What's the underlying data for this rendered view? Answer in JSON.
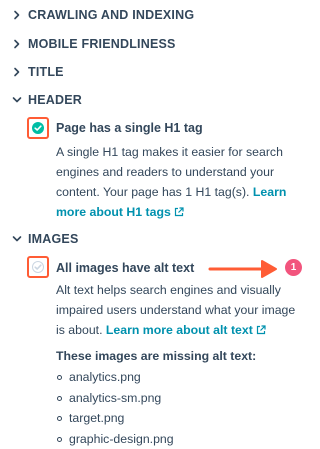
{
  "sections": [
    {
      "label": "CRAWLING AND INDEXING",
      "expanded": false
    },
    {
      "label": "MOBILE FRIENDLINESS",
      "expanded": false
    },
    {
      "label": "TITLE",
      "expanded": false
    },
    {
      "label": "HEADER",
      "expanded": true
    },
    {
      "label": "IMAGES",
      "expanded": true
    }
  ],
  "header": {
    "check_title": "Page has a single H1 tag",
    "status": "pass",
    "description": "A single H1 tag makes it easier for search engines and readers to understand your content. Your page has 1 H1 tag(s). ",
    "link": "Learn more about H1 tags"
  },
  "images": {
    "check_title": "All images have alt text",
    "status": "fail",
    "description": "Alt text helps search engines and visually impaired users understand what your image is about. ",
    "link": "Learn more about alt text",
    "missing_title": "These images are missing alt text:",
    "missing_list": [
      "analytics.png",
      "analytics-sm.png",
      "target.png",
      "graphic-design.png"
    ],
    "badge_count": "1"
  },
  "colors": {
    "accent": "#ff5c35",
    "pass_green": "#00bda5",
    "fail_grey": "#cbd6e2",
    "link": "#0091ae",
    "badge": "#f2547d",
    "text": "#33475b"
  },
  "icons": {
    "collapsed": "chevron-right-icon",
    "expanded": "chevron-down-icon",
    "pass": "check-circle-icon",
    "fail": "check-circle-muted-icon",
    "external": "external-link-icon",
    "annotation": "arrow-right-icon"
  }
}
